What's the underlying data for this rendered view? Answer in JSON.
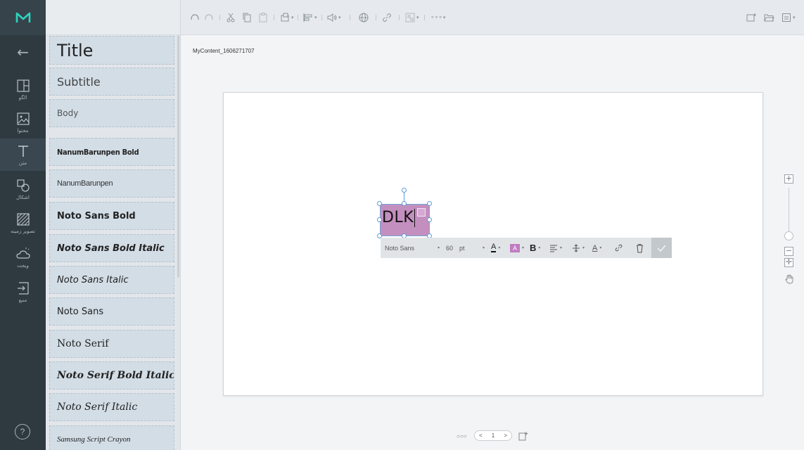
{
  "rail": {
    "logo": "M",
    "items": [
      {
        "label": "الگو",
        "icon": "layout-icon"
      },
      {
        "label": "محتوا",
        "icon": "image-icon"
      },
      {
        "label": "متن",
        "icon": "text-icon"
      },
      {
        "label": "اشکال",
        "icon": "shapes-icon"
      },
      {
        "label": "تصویر زمینه",
        "icon": "background-pattern-icon"
      },
      {
        "label": "ویجت",
        "icon": "widget-weather-icon"
      },
      {
        "label": "منبع",
        "icon": "source-import-icon"
      }
    ],
    "help": "?"
  },
  "styles": [
    {
      "label": "Title"
    },
    {
      "label": "Subtitle"
    },
    {
      "label": "Body"
    },
    {
      "label": "NanumBarunpen Bold"
    },
    {
      "label": "NanumBarunpen"
    },
    {
      "label": "Noto Sans Bold"
    },
    {
      "label": "Noto Sans Bold Italic"
    },
    {
      "label": "Noto Sans Italic"
    },
    {
      "label": "Noto Sans"
    },
    {
      "label": "Noto Serif"
    },
    {
      "label": "Noto Serif Bold Italic"
    },
    {
      "label": "Noto Serif Italic"
    },
    {
      "label": "Samsung Script Crayon"
    }
  ],
  "content_name": "MyContent_1606271707",
  "textbox": {
    "text": "DLK",
    "fill_color": "#c38fbf"
  },
  "floatbar": {
    "font": "Noto Sans",
    "size": "60",
    "unit": "pt",
    "font_color_label": "A",
    "highlight_label": "A",
    "bold_label": "B",
    "text_effect_label": "A"
  },
  "pager": {
    "current_page": "1",
    "prev": "<",
    "next": ">",
    "dots": "○○○"
  },
  "toolbar": {
    "more": "∘∘∘"
  },
  "colors": {
    "accent": "#2dd4bf",
    "rail_bg": "#2f3940",
    "highlight": "#c38fbf"
  }
}
